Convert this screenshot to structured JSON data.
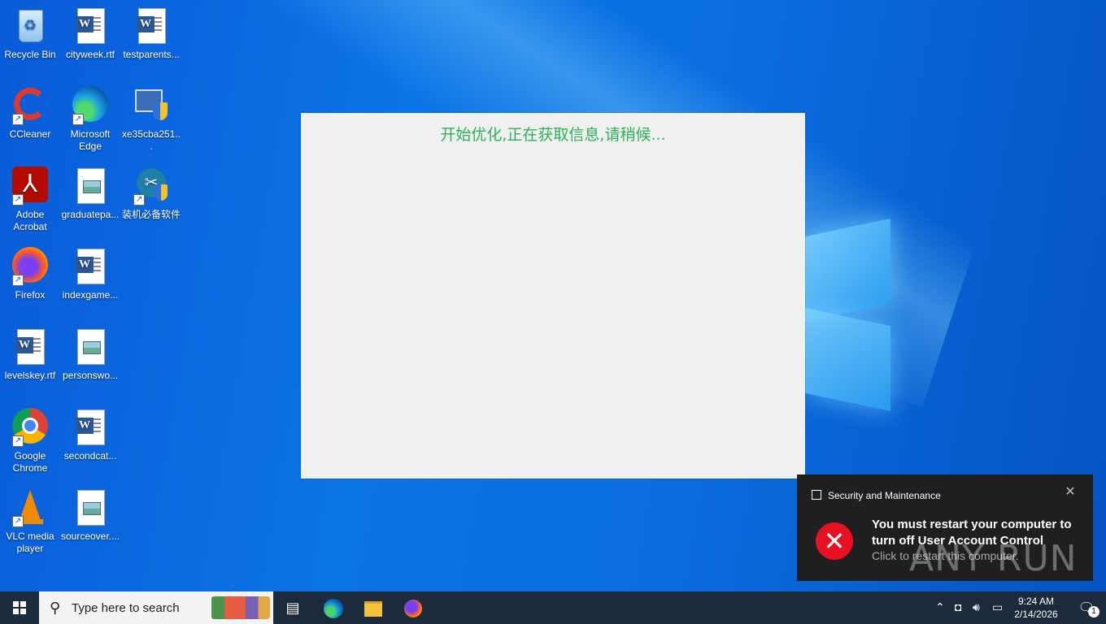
{
  "desktop": {
    "icons": [
      {
        "label": "Recycle Bin"
      },
      {
        "label": "cityweek.rtf"
      },
      {
        "label": "testparents..."
      },
      {
        "label": "CCleaner"
      },
      {
        "label": "Microsoft Edge"
      },
      {
        "label": "xe35cba251..."
      },
      {
        "label": "Adobe Acrobat"
      },
      {
        "label": "graduatepa..."
      },
      {
        "label": "装机必备软件"
      },
      {
        "label": "Firefox"
      },
      {
        "label": "indexgame..."
      },
      {
        "label": "levelskey.rtf"
      },
      {
        "label": "personswo..."
      },
      {
        "label": "Google Chrome"
      },
      {
        "label": "secondcat..."
      },
      {
        "label": "VLC media player"
      },
      {
        "label": "sourceover...."
      }
    ]
  },
  "app_window": {
    "message": "开始优化,正在获取信息,请稍候..."
  },
  "toast": {
    "app_name": "Security and Maintenance",
    "title": "You must restart your computer to turn off User Account Control",
    "body": "Click to restart this computer.",
    "close_glyph": "✕",
    "error_glyph": "✕"
  },
  "watermark": "ANY RUN",
  "taskbar": {
    "search_placeholder": "Type here to search",
    "clock_time": "9:24 AM",
    "clock_date": "2/14/2026",
    "notification_count": "1"
  },
  "colors": {
    "message_green": "#2cb25a",
    "error_red": "#e81123",
    "taskbar": "#1c2a3c"
  }
}
